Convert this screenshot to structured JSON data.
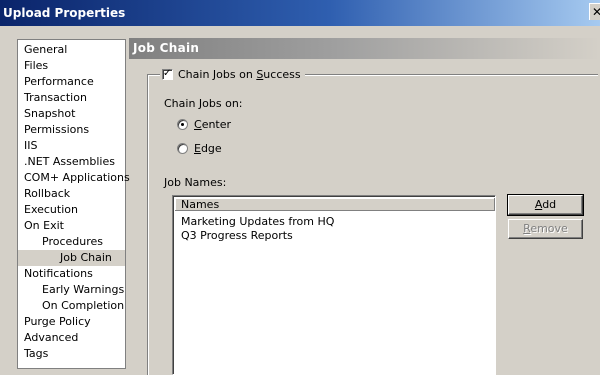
{
  "window": {
    "title": "Upload Properties",
    "close_glyph": "✕"
  },
  "sidebar": {
    "items": [
      {
        "label": "General",
        "indent": 0,
        "selected": false
      },
      {
        "label": "Files",
        "indent": 0,
        "selected": false
      },
      {
        "label": "Performance",
        "indent": 0,
        "selected": false
      },
      {
        "label": "Transaction",
        "indent": 0,
        "selected": false
      },
      {
        "label": "Snapshot",
        "indent": 0,
        "selected": false
      },
      {
        "label": "Permissions",
        "indent": 0,
        "selected": false
      },
      {
        "label": "IIS",
        "indent": 0,
        "selected": false
      },
      {
        "label": ".NET Assemblies",
        "indent": 0,
        "selected": false
      },
      {
        "label": "COM+ Applications",
        "indent": 0,
        "selected": false
      },
      {
        "label": "Rollback",
        "indent": 0,
        "selected": false
      },
      {
        "label": "Execution",
        "indent": 0,
        "selected": false
      },
      {
        "label": "On Exit",
        "indent": 0,
        "selected": false
      },
      {
        "label": "Procedures",
        "indent": 1,
        "selected": false
      },
      {
        "label": "Job Chain",
        "indent": 2,
        "selected": true
      },
      {
        "label": "Notifications",
        "indent": 0,
        "selected": false
      },
      {
        "label": "Early Warnings",
        "indent": 1,
        "selected": false
      },
      {
        "label": "On Completion",
        "indent": 1,
        "selected": false
      },
      {
        "label": "Purge Policy",
        "indent": 0,
        "selected": false
      },
      {
        "label": "Advanced",
        "indent": 0,
        "selected": false
      },
      {
        "label": "Tags",
        "indent": 0,
        "selected": false
      }
    ]
  },
  "panel": {
    "title": "Job Chain",
    "chain_checkbox": {
      "label_pre": "Chain Jobs on ",
      "label_key": "S",
      "label_post": "uccess",
      "checked": true,
      "check_glyph": "✓"
    },
    "chain_on_label": "Chain Jobs on:",
    "radio_center": {
      "key": "C",
      "rest": "enter",
      "selected": true
    },
    "radio_edge": {
      "key": "E",
      "rest": "dge",
      "selected": false
    },
    "job_names_label": "Job Names:",
    "list": {
      "header": "Names",
      "rows": [
        "Marketing Updates from HQ",
        "Q3 Progress Reports"
      ]
    },
    "add_button": {
      "key": "A",
      "rest": "dd"
    },
    "remove_button": {
      "key": "R",
      "rest": "emove",
      "enabled": false
    }
  }
}
